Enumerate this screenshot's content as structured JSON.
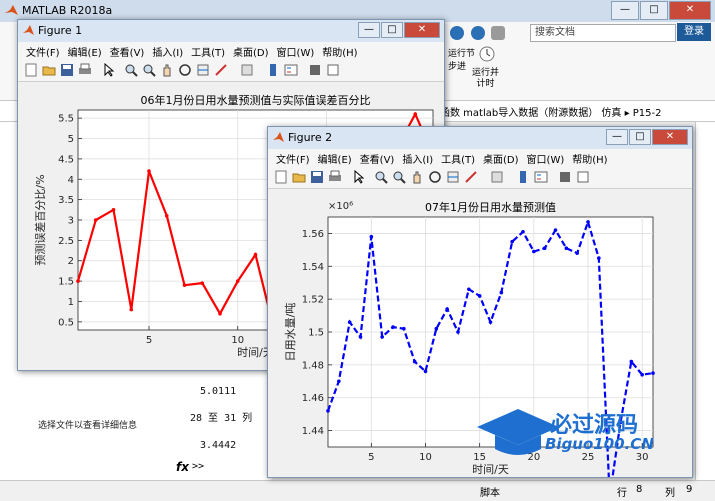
{
  "matlab": {
    "title": "MATLAB R2018a",
    "search_placeholder": "搜索文档",
    "login_label": "登录",
    "run_section_label": "运行节",
    "advance_label": "步进",
    "run_advance_label": "运行并\n计时",
    "path": "函数 matlab导入数据（附源数据） 仿真 ▸ P15-2",
    "detail_text": "选择文件以查看详细信息",
    "cmd_lines": [
      "5.0111",
      "28 至 31 列",
      "3.4442"
    ],
    "fx_label": "fx",
    "prompt": ">>",
    "status_script": "脚本",
    "status_row_label": "行",
    "status_row": "8",
    "status_col_label": "列",
    "status_col": "9"
  },
  "menus": [
    "文件(F)",
    "编辑(E)",
    "查看(V)",
    "插入(I)",
    "工具(T)",
    "桌面(D)",
    "窗口(W)",
    "帮助(H)"
  ],
  "figure1": {
    "title": "Figure 1"
  },
  "figure2": {
    "title": "Figure 2"
  },
  "watermark": {
    "line1": "必过源码",
    "line2": "Biguo100.CN"
  },
  "colors": {
    "fig1_line": "#ff0000",
    "fig2_line": "#0000ff"
  },
  "chart_data": [
    {
      "type": "line",
      "title": "06年1月份日用水量预测值与实际值误差百分比",
      "xlabel": "时间/天",
      "ylabel": "预测误差百分比/%",
      "x": [
        1,
        2,
        3,
        4,
        5,
        6,
        7,
        8,
        9,
        10,
        11,
        12,
        13,
        14,
        15,
        16,
        17,
        18,
        19,
        20,
        21
      ],
      "values": [
        1.5,
        3.0,
        3.25,
        0.8,
        4.2,
        3.1,
        1.4,
        1.45,
        0.7,
        1.5,
        2.15,
        0.38,
        0.75,
        0.78,
        1.85,
        2.55,
        2.8,
        4.35,
        4.8,
        5.6,
        4.6
      ],
      "yticks": [
        0.5,
        1,
        1.5,
        2,
        2.5,
        3,
        3.5,
        4,
        4.5,
        5,
        5.5
      ],
      "xticks": [
        5,
        10,
        15
      ],
      "ylim": [
        0.3,
        5.7
      ],
      "xlim": [
        1,
        21
      ],
      "grid": true,
      "color": "#ff0000"
    },
    {
      "type": "line",
      "title": "07年1月份日用水量预测值",
      "xlabel": "时间/天",
      "ylabel": "日用水量/吨",
      "y_exponent": "×10⁶",
      "x": [
        1,
        2,
        3,
        4,
        5,
        6,
        7,
        8,
        9,
        10,
        11,
        12,
        13,
        14,
        15,
        16,
        17,
        18,
        19,
        20,
        21,
        22,
        23,
        24,
        25,
        26,
        27,
        28,
        29,
        30,
        31
      ],
      "values": [
        1.452,
        1.47,
        1.506,
        1.497,
        1.558,
        1.497,
        1.503,
        1.502,
        1.482,
        1.476,
        1.502,
        1.514,
        1.5,
        1.526,
        1.522,
        1.506,
        1.524,
        1.555,
        1.561,
        1.549,
        1.551,
        1.562,
        1.551,
        1.548,
        1.567,
        1.545,
        1.4,
        1.445,
        1.482,
        1.474,
        1.475
      ],
      "yticks": [
        1.44,
        1.46,
        1.48,
        1.5,
        1.52,
        1.54,
        1.56
      ],
      "xticks": [
        5,
        10,
        15,
        20,
        25,
        30
      ],
      "ylim": [
        1.43,
        1.57
      ],
      "xlim": [
        1,
        31
      ],
      "grid": true,
      "color": "#0000ff"
    }
  ]
}
